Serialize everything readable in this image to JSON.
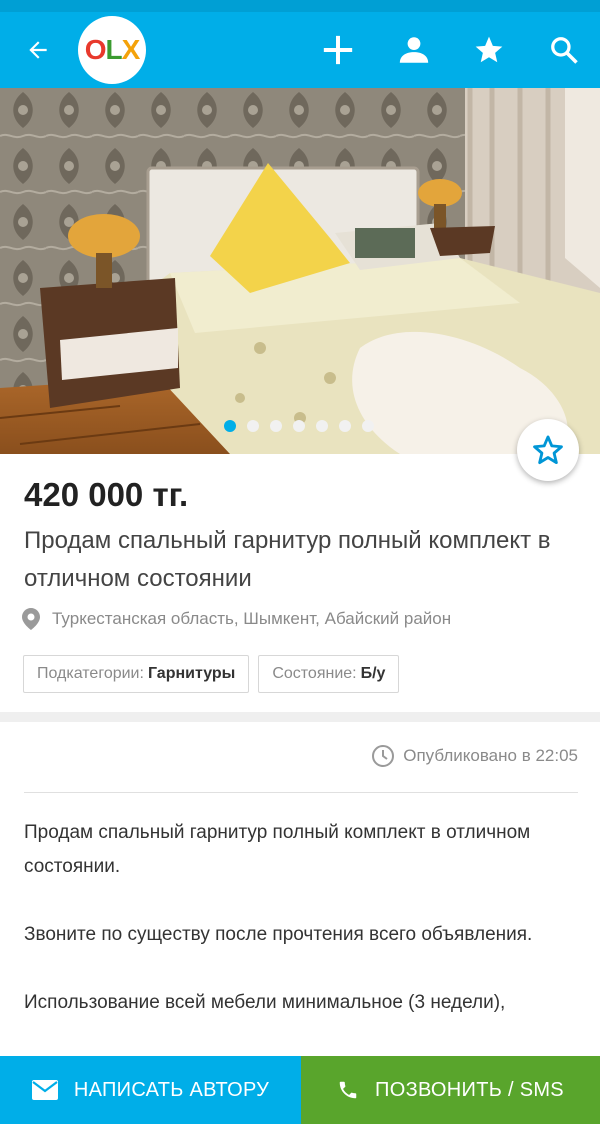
{
  "app": {
    "logo": {
      "o": "O",
      "l": "L",
      "x": "X"
    }
  },
  "header": {
    "icons": [
      "back-arrow-icon",
      "plus-icon",
      "user-icon",
      "star-icon",
      "search-icon"
    ],
    "background": "#00aee8"
  },
  "gallery": {
    "total_images": 7,
    "active_index": 0,
    "image_alt": "bedroom furniture photo"
  },
  "listing": {
    "price": "420 000 тг.",
    "title": "Продам спальный гарнитур полный комплект в отличном состоянии",
    "location": "Туркестанская область, Шымкент, Абайский район",
    "params": [
      {
        "label": "Подкатегории:",
        "value": "Гарнитуры"
      },
      {
        "label": "Состояние:",
        "value": "Б/у"
      }
    ],
    "published": "Опубликовано в 22:05",
    "description": [
      "Продам спальный гарнитур полный комплект в отличном состоянии.",
      "Звоните по существу после прочтения всего объявления.",
      "Использование всей мебели минимальное (3 недели),"
    ]
  },
  "actions": {
    "write_label": "НАПИСАТЬ АВТОРУ",
    "call_label": "ПОЗВОНИТЬ / SMS",
    "write_color": "#00aee8",
    "call_color": "#59a52c"
  }
}
